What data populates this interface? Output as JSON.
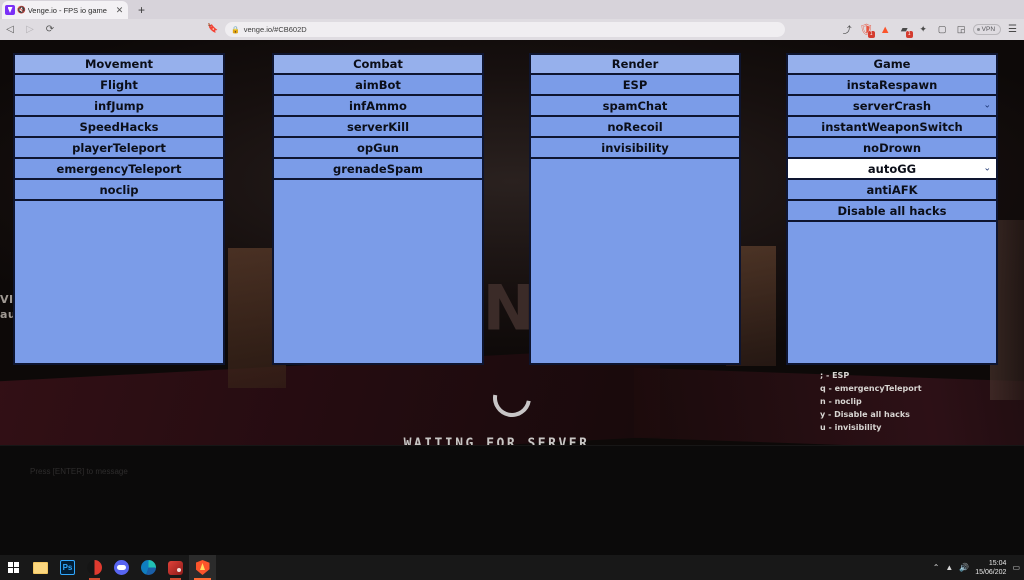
{
  "browser": {
    "tab": {
      "title": "Venge.io - FPS io game",
      "favicon_icon": "venge-logo-icon",
      "mute_icon": "speaker-muted-icon",
      "close_icon": "close-icon"
    },
    "new_tab_label": "+",
    "nav": {
      "back_icon": "back-arrow-icon",
      "forward_icon": "forward-arrow-icon",
      "reload_icon": "reload-icon",
      "bookmark_icon": "bookmark-icon"
    },
    "omnibox": {
      "lock_icon": "lock-icon",
      "url": "venge.io/#CB602D"
    },
    "right_icons": [
      {
        "name": "share-icon",
        "glyph": "⤴"
      },
      {
        "name": "brave-shields-icon",
        "glyph": "◆",
        "badge": "1"
      },
      {
        "name": "brave-rewards-icon",
        "glyph": "▲"
      },
      {
        "name": "extensions-puzzle-icon",
        "glyph": "▰",
        "badge": "1"
      },
      {
        "name": "extension-icon",
        "glyph": "✦"
      },
      {
        "name": "sidebar-icon",
        "glyph": "▢"
      },
      {
        "name": "wallet-icon",
        "glyph": "◲"
      }
    ],
    "vpn_label": "VPN",
    "menu_icon": "hamburger-menu-icon"
  },
  "game": {
    "background_logo": "VENGE",
    "left_overlay_text": "VI\nau",
    "status_text": "WAITING FOR SERVER...",
    "spinner_icon": "loading-spinner-icon",
    "chat_hint": "Press [ENTER] to message"
  },
  "cheat_menu": {
    "panels": [
      {
        "name": "movement",
        "title": "Movement",
        "items": [
          {
            "label": "Flight",
            "chevron": false,
            "selected": false
          },
          {
            "label": "infJump",
            "chevron": false,
            "selected": false
          },
          {
            "label": "SpeedHacks",
            "chevron": false,
            "selected": false
          },
          {
            "label": "playerTeleport",
            "chevron": false,
            "selected": false
          },
          {
            "label": "emergencyTeleport",
            "chevron": false,
            "selected": false
          },
          {
            "label": "noclip",
            "chevron": false,
            "selected": false
          }
        ]
      },
      {
        "name": "combat",
        "title": "Combat",
        "items": [
          {
            "label": "aimBot",
            "chevron": false,
            "selected": false
          },
          {
            "label": "infAmmo",
            "chevron": false,
            "selected": false
          },
          {
            "label": "serverKill",
            "chevron": false,
            "selected": false
          },
          {
            "label": "opGun",
            "chevron": false,
            "selected": false
          },
          {
            "label": "grenadeSpam",
            "chevron": false,
            "selected": false
          }
        ]
      },
      {
        "name": "render",
        "title": "Render",
        "items": [
          {
            "label": "ESP",
            "chevron": false,
            "selected": false
          },
          {
            "label": "spamChat",
            "chevron": false,
            "selected": false
          },
          {
            "label": "noRecoil",
            "chevron": false,
            "selected": false
          },
          {
            "label": "invisibility",
            "chevron": false,
            "selected": false
          }
        ]
      },
      {
        "name": "game",
        "title": "Game",
        "items": [
          {
            "label": "instaRespawn",
            "chevron": false,
            "selected": false
          },
          {
            "label": "serverCrash",
            "chevron": true,
            "selected": false
          },
          {
            "label": "instantWeaponSwitch",
            "chevron": false,
            "selected": false
          },
          {
            "label": "noDrown",
            "chevron": false,
            "selected": false
          },
          {
            "label": "autoGG",
            "chevron": true,
            "selected": true
          },
          {
            "label": "antiAFK",
            "chevron": false,
            "selected": false
          },
          {
            "label": "Disable all hacks",
            "chevron": false,
            "selected": false
          }
        ]
      }
    ],
    "colors": {
      "panel_header": "#96b0ec",
      "panel_row": "#7b9ce8",
      "panel_border": "#0e1530",
      "row_selected": "#ffffff",
      "text": "#0b0e18"
    },
    "keybinds": [
      "; - ESP",
      "q - emergencyTeleport",
      "n - noclip",
      "y - Disable all hacks",
      "u - invisibility"
    ]
  },
  "taskbar": {
    "items": [
      {
        "name": "start-button",
        "icon": "windows-start-icon"
      },
      {
        "name": "file-explorer",
        "icon": "folder-icon"
      },
      {
        "name": "photoshop",
        "icon": "photoshop-icon",
        "label": "Ps"
      },
      {
        "name": "app-red-circle",
        "icon": "red-circle-app-icon"
      },
      {
        "name": "discord",
        "icon": "discord-icon"
      },
      {
        "name": "microsoft-edge",
        "icon": "edge-icon"
      },
      {
        "name": "app-red-square",
        "icon": "red-app-icon"
      },
      {
        "name": "brave-browser",
        "icon": "brave-icon"
      }
    ],
    "tray": {
      "show_hidden_icon": "chevron-up-icon",
      "network_icon": "wifi-icon",
      "volume_icon": "speaker-icon",
      "time": "15:04",
      "date": "15/06/202",
      "notifications_icon": "notification-icon"
    }
  }
}
